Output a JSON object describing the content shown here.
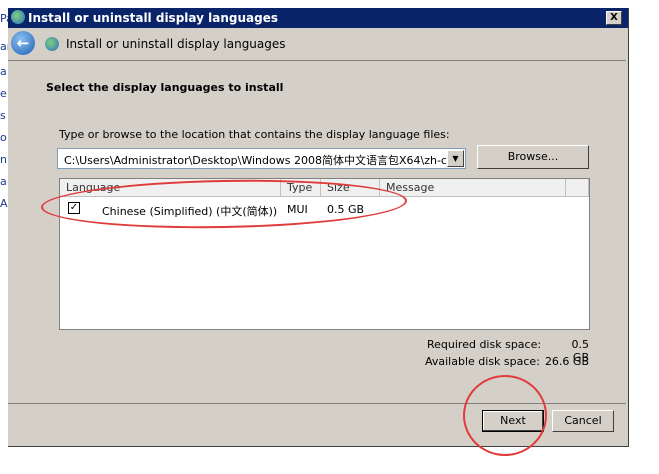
{
  "background_fragments": [
    "Pa",
    "ar",
    "a",
    "e",
    "s",
    "o",
    "n",
    "a",
    "Ar"
  ],
  "window": {
    "title": "Install or uninstall display languages",
    "close_label": "X"
  },
  "header": {
    "title": "Install or uninstall display languages"
  },
  "main": {
    "heading": "Select the display languages to install",
    "location_label": "Type or browse to the location that contains the display language files:",
    "location_value": "C:\\Users\\Administrator\\Desktop\\Windows 2008简体中文语言包X64\\zh-c",
    "browse_label": "Browse...",
    "columns": [
      "Language",
      "Type",
      "Size",
      "Message"
    ],
    "rows": [
      {
        "checked": true,
        "language": "Chinese (Simplified) (中文(简体))",
        "type": "MUI",
        "size": "0.5 GB",
        "message": ""
      }
    ],
    "required_label": "Required disk space:",
    "required_value": "0.5 GB",
    "available_label": "Available disk space:",
    "available_value": "26.6 GB"
  },
  "footer": {
    "next_label": "Next",
    "cancel_label": "Cancel"
  }
}
